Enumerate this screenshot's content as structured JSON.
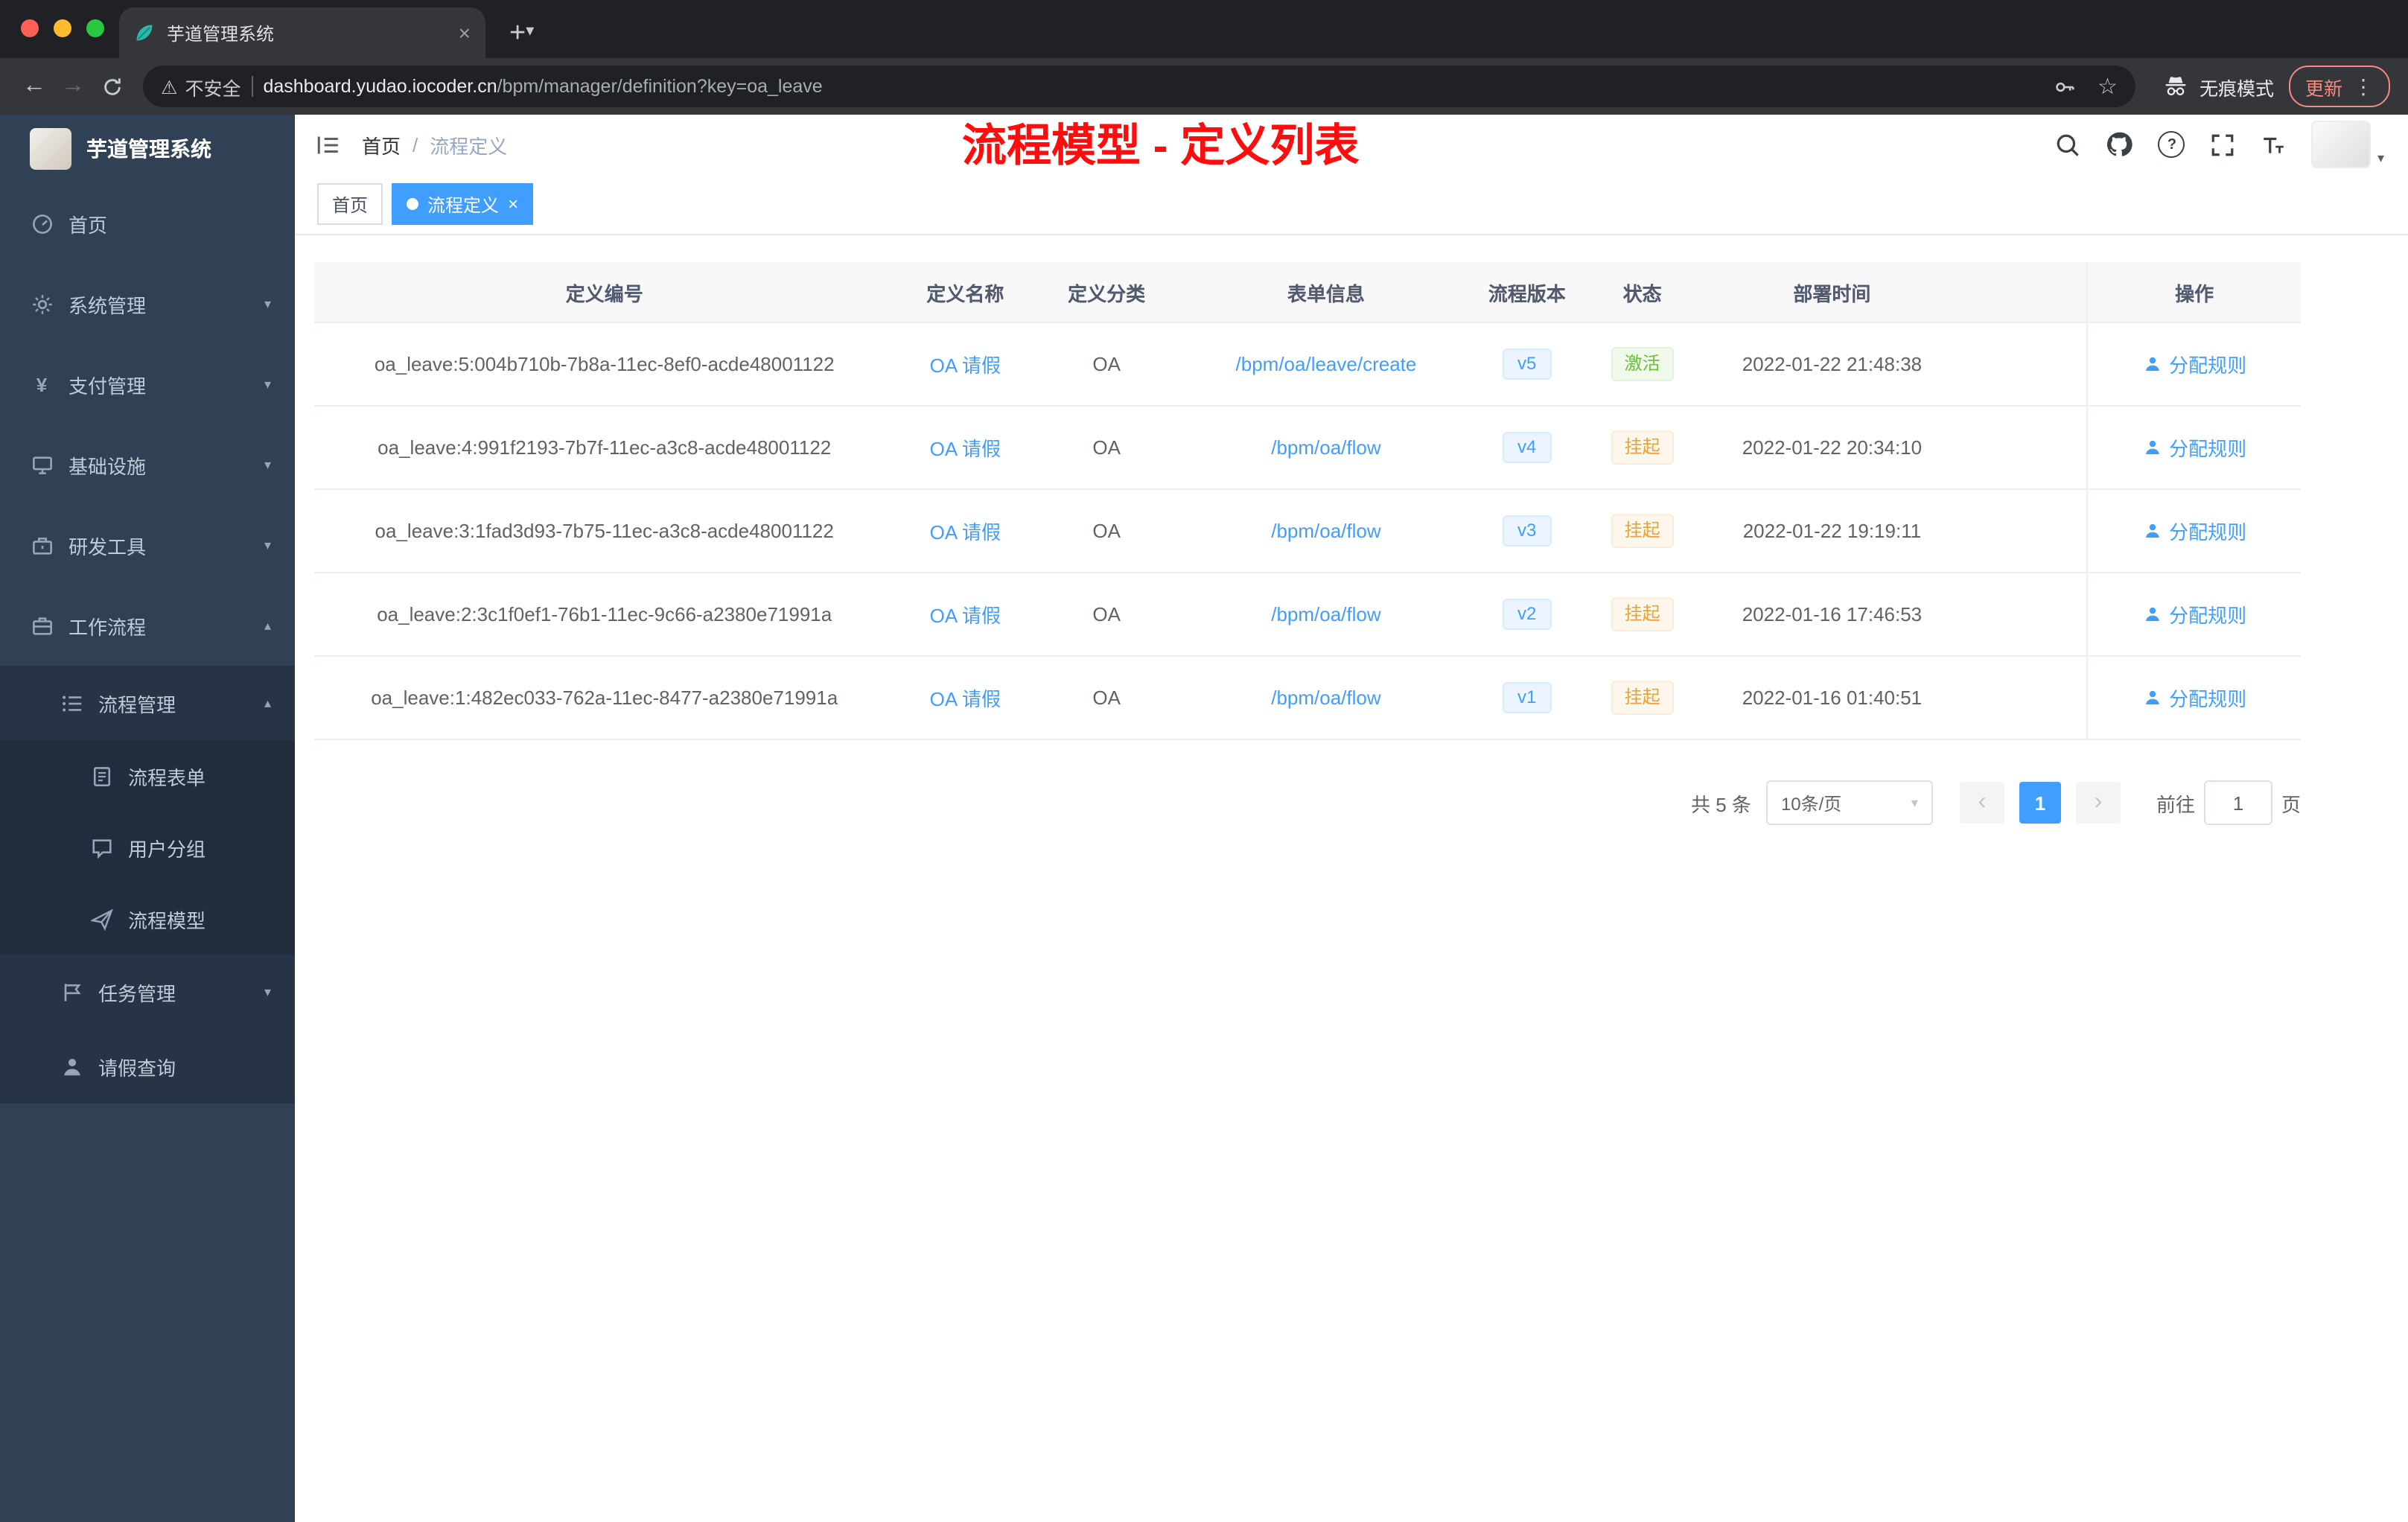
{
  "browser": {
    "tab_title": "芋道管理系统",
    "security_label": "不安全",
    "url_domain": "dashboard.yudao.iocoder.cn",
    "url_path": "/bpm/manager/definition?key=oa_leave",
    "incognito_label": "无痕模式",
    "update_label": "更新"
  },
  "icons": {
    "close": "×",
    "plus": "+",
    "back": "←",
    "forward": "→",
    "star": "☆",
    "warning": "⚠",
    "more": "⋮",
    "caret_down": "▾",
    "caret_up": "▴",
    "prev": "‹",
    "next": "›",
    "yen": "¥",
    "question": "?"
  },
  "sidebar": {
    "logo_title": "芋道管理系统",
    "menu": [
      {
        "label": "首页",
        "icon": "dashboard-icon"
      },
      {
        "label": "系统管理",
        "icon": "gear-icon"
      },
      {
        "label": "支付管理",
        "icon": "yen-icon"
      },
      {
        "label": "基础设施",
        "icon": "monitor-icon"
      },
      {
        "label": "研发工具",
        "icon": "toolbox-icon"
      },
      {
        "label": "工作流程",
        "icon": "briefcase-icon"
      },
      {
        "label": "流程管理",
        "icon": "list-icon"
      },
      {
        "label": "流程表单",
        "icon": "form-icon"
      },
      {
        "label": "用户分组",
        "icon": "chat-icon"
      },
      {
        "label": "流程模型",
        "icon": "paper-plane-icon"
      },
      {
        "label": "任务管理",
        "icon": "flag-icon"
      },
      {
        "label": "请假查询",
        "icon": "person-icon"
      }
    ]
  },
  "header": {
    "breadcrumb": [
      "首页",
      "流程定义"
    ],
    "breadcrumb_separator": "/",
    "annotation": "流程模型 - 定义列表"
  },
  "tags": [
    {
      "label": "首页"
    },
    {
      "label": "流程定义"
    }
  ],
  "table": {
    "columns": [
      "定义编号",
      "定义名称",
      "定义分类",
      "表单信息",
      "流程版本",
      "状态",
      "部署时间",
      "操作"
    ],
    "rows": [
      {
        "id": "oa_leave:5:004b710b-7b8a-11ec-8ef0-acde48001122",
        "name": "OA 请假",
        "category": "OA",
        "form": "/bpm/oa/leave/create",
        "version": "v5",
        "status": "激活",
        "time": "2022-01-22 21:48:38",
        "action": "分配规则"
      },
      {
        "id": "oa_leave:4:991f2193-7b7f-11ec-a3c8-acde48001122",
        "name": "OA 请假",
        "category": "OA",
        "form": "/bpm/oa/flow",
        "version": "v4",
        "status": "挂起",
        "time": "2022-01-22 20:34:10",
        "action": "分配规则"
      },
      {
        "id": "oa_leave:3:1fad3d93-7b75-11ec-a3c8-acde48001122",
        "name": "OA 请假",
        "category": "OA",
        "form": "/bpm/oa/flow",
        "version": "v3",
        "status": "挂起",
        "time": "2022-01-22 19:19:11",
        "action": "分配规则"
      },
      {
        "id": "oa_leave:2:3c1f0ef1-76b1-11ec-9c66-a2380e71991a",
        "name": "OA 请假",
        "category": "OA",
        "form": "/bpm/oa/flow",
        "version": "v2",
        "status": "挂起",
        "time": "2022-01-16 17:46:53",
        "action": "分配规则"
      },
      {
        "id": "oa_leave:1:482ec033-762a-11ec-8477-a2380e71991a",
        "name": "OA 请假",
        "category": "OA",
        "form": "/bpm/oa/flow",
        "version": "v1",
        "status": "挂起",
        "time": "2022-01-16 01:40:51",
        "action": "分配规则"
      }
    ]
  },
  "pagination": {
    "total": "共 5 条",
    "page_size": "10条/页",
    "page": "1",
    "goto_label": "前往",
    "goto_value": "1",
    "goto_unit": "页"
  },
  "colors": {
    "accent": "#409eff",
    "success": "#67c23a",
    "warning": "#e6a23c",
    "annotation": "#fd0d0d",
    "sidebar_bg": "#304156",
    "sidebar_sub_bg": "#1f2d3d"
  }
}
